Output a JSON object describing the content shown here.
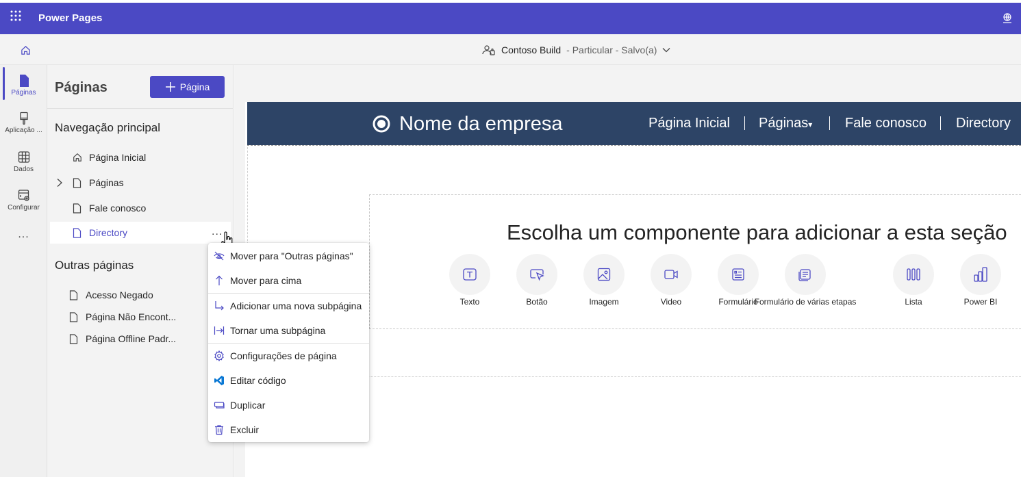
{
  "app": {
    "name": "Power Pages"
  },
  "commandbar": {
    "site_name": "Contoso Build",
    "site_status": "- Particular - Salvo(a)"
  },
  "rail": {
    "items": [
      {
        "label": "Páginas",
        "icon": "page-icon",
        "active": true
      },
      {
        "label": "Aplicação ...",
        "icon": "paintbrush-icon"
      },
      {
        "label": "Dados",
        "icon": "table-icon"
      },
      {
        "label": "Configurar",
        "icon": "settings-page-icon"
      },
      {
        "label": "...",
        "icon": "more-icon"
      }
    ]
  },
  "panel": {
    "title": "Páginas",
    "add_button": "Página",
    "main_nav_title": "Navegação principal",
    "main_nav": [
      {
        "label": "Página Inicial",
        "icon": "home-icon"
      },
      {
        "label": "Páginas",
        "icon": "page-icon",
        "expandable": true
      },
      {
        "label": "Fale conosco",
        "icon": "page-icon"
      },
      {
        "label": "Directory",
        "icon": "page-icon",
        "selected": true
      }
    ],
    "more_label": "...",
    "other_title": "Outras páginas",
    "other_pages": [
      {
        "label": "Acesso Negado"
      },
      {
        "label": "Página Não Encont..."
      },
      {
        "label": "Página Offline Padr..."
      }
    ]
  },
  "context_menu": {
    "items": [
      {
        "label": "Mover para \"Outras páginas\"",
        "icon": "eye-hidden-icon"
      },
      {
        "label": "Mover para cima",
        "icon": "arrow-up-icon"
      },
      {
        "label": "Adicionar uma nova subpágina",
        "icon": "subpage-add-icon"
      },
      {
        "label": "Tornar uma subpágina",
        "icon": "indent-icon"
      },
      {
        "label": "Configurações de página",
        "icon": "gear-icon"
      },
      {
        "label": "Editar código",
        "icon": "vscode-icon"
      },
      {
        "label": "Duplicar",
        "icon": "duplicate-icon"
      },
      {
        "label": "Excluir",
        "icon": "trash-icon"
      }
    ]
  },
  "site": {
    "company_name": "Nome da empresa",
    "nav": [
      "Página Inicial",
      "Páginas",
      "Fale conosco",
      "Directory"
    ],
    "dropdown_caret": "▾",
    "choose_text": "Escolha um componente para adicionar a esta seção",
    "components": [
      {
        "label": "Texto",
        "icon": "text-icon"
      },
      {
        "label": "Botão",
        "icon": "button-icon"
      },
      {
        "label": "Imagem",
        "icon": "image-icon"
      },
      {
        "label": "Video",
        "icon": "video-icon"
      },
      {
        "label": "Formulário",
        "icon": "form-icon"
      },
      {
        "label": "Formulário de várias etapas",
        "icon": "multistep-form-icon"
      },
      {
        "label": "Lista",
        "icon": "list-icon"
      },
      {
        "label": "Power BI",
        "icon": "powerbi-icon"
      }
    ]
  },
  "colors": {
    "brand": "#4b49c4",
    "site_header": "#2d4466"
  }
}
